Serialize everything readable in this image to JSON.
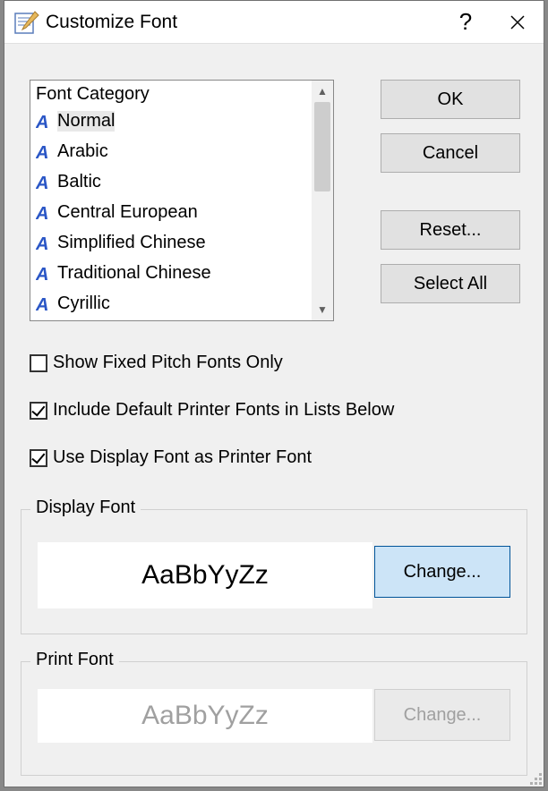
{
  "title": "Customize Font",
  "buttons": {
    "ok": "OK",
    "cancel": "Cancel",
    "reset": "Reset...",
    "select_all": "Select All",
    "change": "Change..."
  },
  "listbox": {
    "header": "Font Category",
    "items": [
      {
        "label": "Normal",
        "selected": true
      },
      {
        "label": "Arabic",
        "selected": false
      },
      {
        "label": "Baltic",
        "selected": false
      },
      {
        "label": "Central European",
        "selected": false
      },
      {
        "label": "Simplified Chinese",
        "selected": false
      },
      {
        "label": "Traditional Chinese",
        "selected": false
      },
      {
        "label": "Cyrillic",
        "selected": false
      }
    ]
  },
  "checks": {
    "fixed_pitch": {
      "label": "Show Fixed Pitch Fonts Only",
      "checked": false
    },
    "include_printer": {
      "label": "Include Default Printer Fonts in Lists Below",
      "checked": true
    },
    "use_display": {
      "label": "Use Display Font as Printer Font",
      "checked": true
    }
  },
  "groups": {
    "display": {
      "legend": "Display Font",
      "sample": "AaBbYyZz"
    },
    "print": {
      "legend": "Print Font",
      "sample": "AaBbYyZz"
    }
  }
}
